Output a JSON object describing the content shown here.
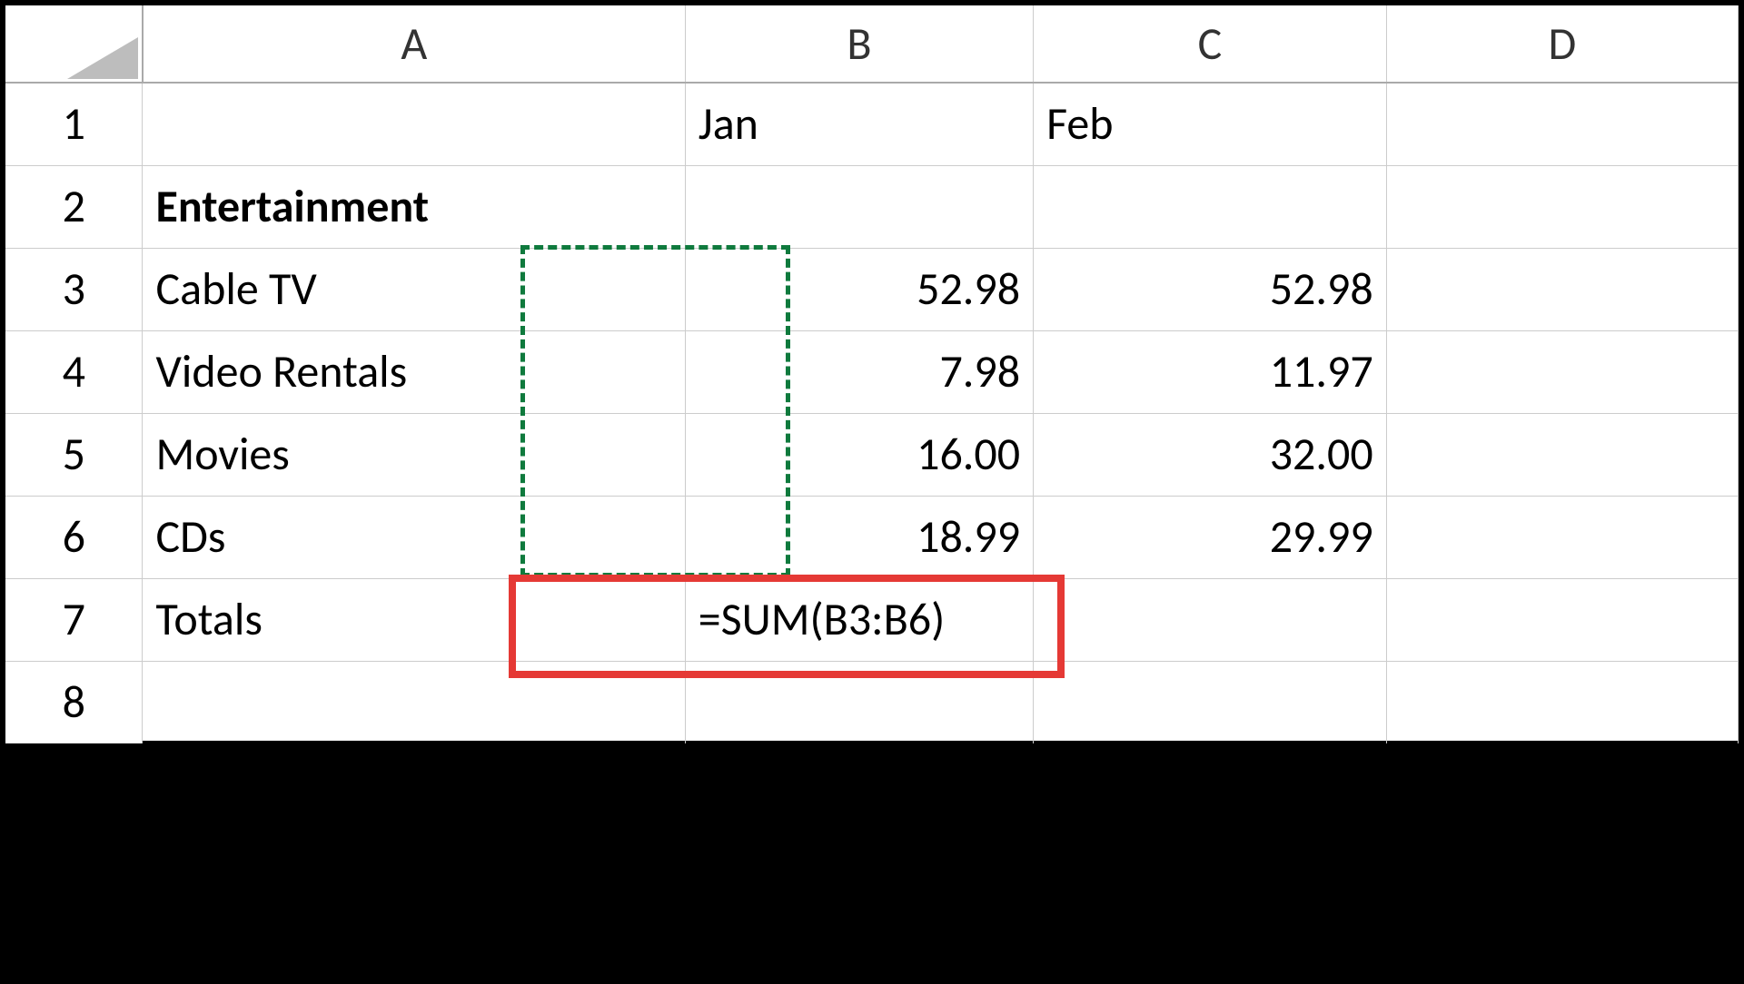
{
  "columns": {
    "A": "A",
    "B": "B",
    "C": "C",
    "D": "D"
  },
  "rows": {
    "r1": "1",
    "r2": "2",
    "r3": "3",
    "r4": "4",
    "r5": "5",
    "r6": "6",
    "r7": "7",
    "r8": "8"
  },
  "cells": {
    "B1": "Jan",
    "C1": "Feb",
    "A2": "Entertainment",
    "A3": "Cable TV",
    "B3": "52.98",
    "C3": "52.98",
    "A4": "Video Rentals",
    "B4": "7.98",
    "C4": "11.97",
    "A5": "Movies",
    "B5": "16.00",
    "C5": "32.00",
    "A6": "CDs",
    "B6": "18.99",
    "C6": "29.99",
    "A7": "Totals",
    "B7": "=SUM(B3:B6)"
  },
  "selection": {
    "formula_range": "B3:B6",
    "active_cell": "B7"
  }
}
